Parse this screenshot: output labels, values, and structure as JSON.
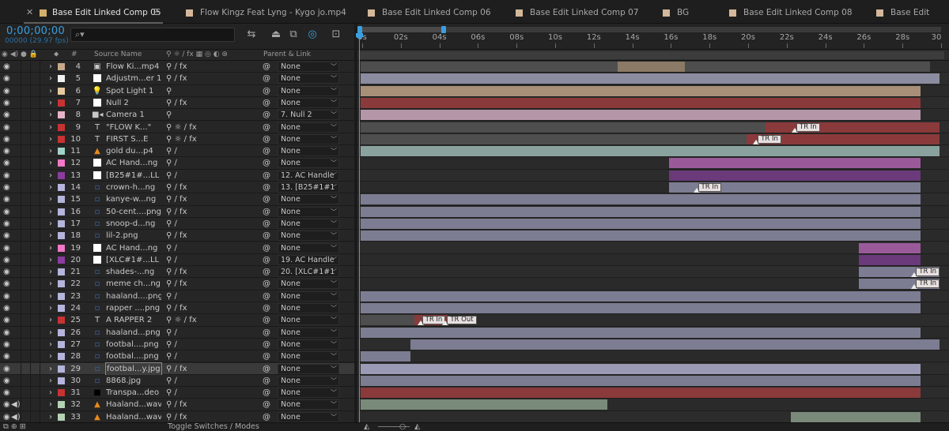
{
  "tabs": [
    {
      "label": "Base Edit Linked Comp 05",
      "active": true,
      "color": "#d4b06a"
    },
    {
      "label": "Flow Kingz Feat Lyng - Kygo jo.mp4",
      "active": false,
      "color": "#d4b89a"
    },
    {
      "label": "Base Edit Linked Comp 06",
      "active": false,
      "color": "#d4b89a"
    },
    {
      "label": "Base Edit Linked Comp 07",
      "active": false,
      "color": "#d4b89a"
    },
    {
      "label": "BG",
      "active": false,
      "color": "#d4b89a"
    },
    {
      "label": "Base Edit Linked Comp 08",
      "active": false,
      "color": "#d4b89a"
    },
    {
      "label": "Base Edit",
      "active": false,
      "color": "#d4b89a"
    }
  ],
  "header": {
    "timecode": "0;00;00;00",
    "fps": "00000 (29.97 fps)",
    "search_icon": "search-icon"
  },
  "ruler": {
    "ticks": [
      "0s",
      "02s",
      "04s",
      "06s",
      "08s",
      "10s",
      "12s",
      "14s",
      "16s",
      "18s",
      "20s",
      "22s",
      "24s",
      "26s",
      "28s",
      "30"
    ]
  },
  "columns": {
    "source_name": "Source Name",
    "parent_link": "Parent & Link",
    "hash": "#"
  },
  "layers": [
    {
      "num": "4",
      "label_color": "#c8a888",
      "type": "comp",
      "name": "Flow Ki...mp4",
      "switches": "⚲ ∕ fx",
      "pick": "⊛",
      "parent": "None"
    },
    {
      "num": "5",
      "label_color": "#f0f0f0",
      "type": "solid",
      "name": "Adjustm...er 1",
      "switches": "⚲ ∕ fx",
      "pick": "⊛",
      "parent": "None"
    },
    {
      "num": "6",
      "label_color": "#e6c8a0",
      "type": "light",
      "name": "Spot Light 1",
      "switches": "⚲",
      "pick": "⊛",
      "parent": "None"
    },
    {
      "num": "7",
      "label_color": "#c83232",
      "type": "solid",
      "name": "Null 2",
      "switches": "⚲ ∕ fx",
      "pick": "⊛",
      "parent": "None"
    },
    {
      "num": "8",
      "label_color": "#e6b4c8",
      "type": "camera",
      "name": "Camera 1",
      "switches": "⚲",
      "pick": "⊛",
      "parent": "7. Null 2"
    },
    {
      "num": "9",
      "label_color": "#c83232",
      "type": "text",
      "name": "\"FLOW K...\"",
      "switches": "⚲ ☼ ∕ fx",
      "pick": "⊛",
      "parent": "None"
    },
    {
      "num": "10",
      "label_color": "#c83232",
      "type": "text",
      "name": "FIRST S...E",
      "switches": "⚲ ☼ ∕ fx",
      "pick": "⊛",
      "parent": "None"
    },
    {
      "num": "11",
      "label_color": "#a0d2c8",
      "type": "vlc",
      "name": "gold du...p4",
      "switches": "⚲ ∕",
      "pick": "⊛",
      "parent": "None"
    },
    {
      "num": "12",
      "label_color": "#f078c8",
      "type": "solid",
      "name": "AC Hand...ng",
      "switches": "⚲ ∕",
      "pick": "⊛",
      "parent": "None"
    },
    {
      "num": "13",
      "label_color": "#8c3ca0",
      "type": "solid",
      "name": "[B25#1#...LL 1",
      "switches": "⚲ ∕",
      "pick": "⊛",
      "parent": "12. AC Handle"
    },
    {
      "num": "14",
      "label_color": "#b4b4dc",
      "type": "image",
      "name": "crown-h...ng",
      "switches": "⚲ ∕ fx",
      "pick": "⊛",
      "parent": "13. [B25#1#1"
    },
    {
      "num": "15",
      "label_color": "#b4b4dc",
      "type": "image",
      "name": "kanye-w...ng",
      "switches": "⚲ ∕ fx",
      "pick": "⊛",
      "parent": "None"
    },
    {
      "num": "16",
      "label_color": "#b4b4dc",
      "type": "image",
      "name": "50-cent....png",
      "switches": "⚲ ∕ fx",
      "pick": "⊛",
      "parent": "None"
    },
    {
      "num": "17",
      "label_color": "#b4b4dc",
      "type": "image",
      "name": "snoop-d...ng",
      "switches": "⚲ ∕",
      "pick": "⊛",
      "parent": "None"
    },
    {
      "num": "18",
      "label_color": "#b4b4dc",
      "type": "image",
      "name": "lil-2.png",
      "switches": "⚲ ∕ fx",
      "pick": "⊛",
      "parent": "None"
    },
    {
      "num": "19",
      "label_color": "#f078c8",
      "type": "solid",
      "name": "AC Hand...ng",
      "switches": "⚲ ∕",
      "pick": "⊛",
      "parent": "None"
    },
    {
      "num": "20",
      "label_color": "#8c3ca0",
      "type": "solid",
      "name": "[XLC#1#...LL 1",
      "switches": "⚲ ∕",
      "pick": "⊛",
      "parent": "19. AC Handle"
    },
    {
      "num": "21",
      "label_color": "#b4b4dc",
      "type": "image",
      "name": "shades-...ng",
      "switches": "⚲ ∕ fx",
      "pick": "⊛",
      "parent": "20. [XLC#1#1"
    },
    {
      "num": "22",
      "label_color": "#b4b4dc",
      "type": "image",
      "name": "meme ch...ng",
      "switches": "⚲ ∕ fx",
      "pick": "⊛",
      "parent": "None"
    },
    {
      "num": "23",
      "label_color": "#b4b4dc",
      "type": "image",
      "name": "haaland....png",
      "switches": "⚲ ∕",
      "pick": "⊛",
      "parent": "None"
    },
    {
      "num": "24",
      "label_color": "#b4b4dc",
      "type": "image",
      "name": "rapper ....png",
      "switches": "⚲ ∕ fx",
      "pick": "⊛",
      "parent": "None"
    },
    {
      "num": "25",
      "label_color": "#c83232",
      "type": "text",
      "name": "A RAPPER 2",
      "switches": "⚲ ☼ ∕ fx",
      "pick": "⊛",
      "parent": "None"
    },
    {
      "num": "26",
      "label_color": "#b4b4dc",
      "type": "image",
      "name": "haaland...png",
      "switches": "⚲ ∕",
      "pick": "⊛",
      "parent": "None"
    },
    {
      "num": "27",
      "label_color": "#b4b4dc",
      "type": "image",
      "name": "footbal....png",
      "switches": "⚲ ∕",
      "pick": "⊛",
      "parent": "None"
    },
    {
      "num": "28",
      "label_color": "#b4b4dc",
      "type": "image",
      "name": "footbal....png",
      "switches": "⚲ ∕",
      "pick": "⊛",
      "parent": "None"
    },
    {
      "num": "29",
      "label_color": "#b4b4dc",
      "type": "image",
      "name": "footbal...y.jpg",
      "switches": "⚲ ∕ fx",
      "pick": "⊛",
      "parent": "None",
      "selected": true
    },
    {
      "num": "30",
      "label_color": "#b4b4dc",
      "type": "image",
      "name": "8868.jpg",
      "switches": "⚲ ∕",
      "pick": "⊛",
      "parent": "None"
    },
    {
      "num": "31",
      "label_color": "#c83232",
      "type": "black",
      "name": "Transpa...deo",
      "switches": "⚲ ∕",
      "pick": "⊛",
      "parent": "None"
    },
    {
      "num": "32",
      "label_color": "#b4d2b4",
      "type": "vlc",
      "name": "Haaland...wav",
      "switches": "⚲ ∕ fx",
      "pick": "⊛",
      "parent": "None",
      "audio": true
    },
    {
      "num": "33",
      "label_color": "#b4d2b4",
      "type": "vlc",
      "name": "Haaland...wav",
      "switches": "⚲ ∕ fx",
      "pick": "⊛",
      "parent": "None",
      "audio": true
    }
  ],
  "tracks": [
    {
      "segments": [
        {
          "from": 0,
          "to": 29.5,
          "color": "#4e4e4e"
        },
        {
          "from": 13.3,
          "to": 16.8,
          "color": "#8a7a66"
        }
      ]
    },
    {
      "segments": [
        {
          "from": 0,
          "to": 30,
          "color": "#8c8ca0"
        }
      ]
    },
    {
      "segments": [
        {
          "from": 0,
          "to": 29,
          "color": "#a89078"
        }
      ]
    },
    {
      "segments": [
        {
          "from": 0,
          "to": 29,
          "color": "#8a3a3a"
        }
      ]
    },
    {
      "segments": [
        {
          "from": 0,
          "to": 29,
          "color": "#b496a8"
        }
      ]
    },
    {
      "segments": [
        {
          "from": 0,
          "to": 21,
          "color": "#4e4e4e"
        },
        {
          "from": 21,
          "to": 30,
          "color": "#8a3a3a"
        }
      ],
      "keys": [
        {
          "t": 22.5,
          "label": "TR In"
        }
      ]
    },
    {
      "segments": [
        {
          "from": 0,
          "to": 20,
          "color": "#4e4e4e"
        },
        {
          "from": 20,
          "to": 30,
          "color": "#8a3a3a"
        }
      ],
      "keys": [
        {
          "t": 20.5,
          "label": "TR In"
        }
      ]
    },
    {
      "segments": [
        {
          "from": 0,
          "to": 30,
          "color": "#8aa29e"
        }
      ]
    },
    {
      "segments": [
        {
          "from": 16,
          "to": 29,
          "color": "#9a5a9a"
        }
      ]
    },
    {
      "segments": [
        {
          "from": 16,
          "to": 29,
          "color": "#6a3a7a"
        }
      ]
    },
    {
      "segments": [
        {
          "from": 16,
          "to": 29,
          "color": "#7c7c92"
        }
      ],
      "keys": [
        {
          "t": 17.4,
          "label": "TR In"
        }
      ]
    },
    {
      "segments": [
        {
          "from": 0,
          "to": 29,
          "color": "#7c7c92"
        }
      ]
    },
    {
      "segments": [
        {
          "from": 0,
          "to": 29,
          "color": "#7c7c92"
        }
      ]
    },
    {
      "segments": [
        {
          "from": 0,
          "to": 29,
          "color": "#7c7c92"
        }
      ]
    },
    {
      "segments": [
        {
          "from": 0,
          "to": 29,
          "color": "#7c7c92"
        }
      ]
    },
    {
      "segments": [
        {
          "from": 25.8,
          "to": 29,
          "color": "#9a5a9a"
        }
      ]
    },
    {
      "segments": [
        {
          "from": 25.8,
          "to": 29,
          "color": "#6a3a7a"
        }
      ]
    },
    {
      "segments": [
        {
          "from": 25.8,
          "to": 30,
          "color": "#7c7c92"
        }
      ],
      "keys": [
        {
          "t": 28.7,
          "label": "TR In"
        }
      ]
    },
    {
      "segments": [
        {
          "from": 25.8,
          "to": 30,
          "color": "#7c7c92"
        }
      ],
      "keys": [
        {
          "t": 28.7,
          "label": "TR In"
        }
      ]
    },
    {
      "segments": [
        {
          "from": 0,
          "to": 29,
          "color": "#7c7c92"
        }
      ]
    },
    {
      "segments": [
        {
          "from": 0,
          "to": 29,
          "color": "#7c7c92"
        }
      ]
    },
    {
      "segments": [
        {
          "from": 0,
          "to": 4.5,
          "color": "#4e4e4e"
        },
        {
          "from": 2.8,
          "to": 4.5,
          "color": "#8a3a3a"
        }
      ],
      "keys": [
        {
          "t": 3.1,
          "label": "TR In"
        },
        {
          "t": 4.4,
          "label": "TR Out"
        }
      ]
    },
    {
      "segments": [
        {
          "from": 0,
          "to": 29,
          "color": "#7c7c92"
        }
      ]
    },
    {
      "segments": [
        {
          "from": 2.6,
          "to": 30,
          "color": "#7c7c92"
        }
      ]
    },
    {
      "segments": [
        {
          "from": 0,
          "to": 2.6,
          "color": "#7c7c92"
        }
      ]
    },
    {
      "segments": [
        {
          "from": 0,
          "to": 29,
          "color": "#9a9ab4"
        }
      ]
    },
    {
      "segments": [
        {
          "from": 0,
          "to": 29,
          "color": "#7c7c92"
        }
      ]
    },
    {
      "segments": [
        {
          "from": 0,
          "to": 29,
          "color": "#8a3a3a"
        }
      ]
    },
    {
      "segments": [
        {
          "from": 0,
          "to": 12.8,
          "color": "#7a8a7a"
        }
      ]
    },
    {
      "segments": [
        {
          "from": 22.3,
          "to": 29,
          "color": "#7a8a7a"
        }
      ]
    }
  ],
  "footer": {
    "toggle_label": "Toggle Switches / Modes"
  }
}
